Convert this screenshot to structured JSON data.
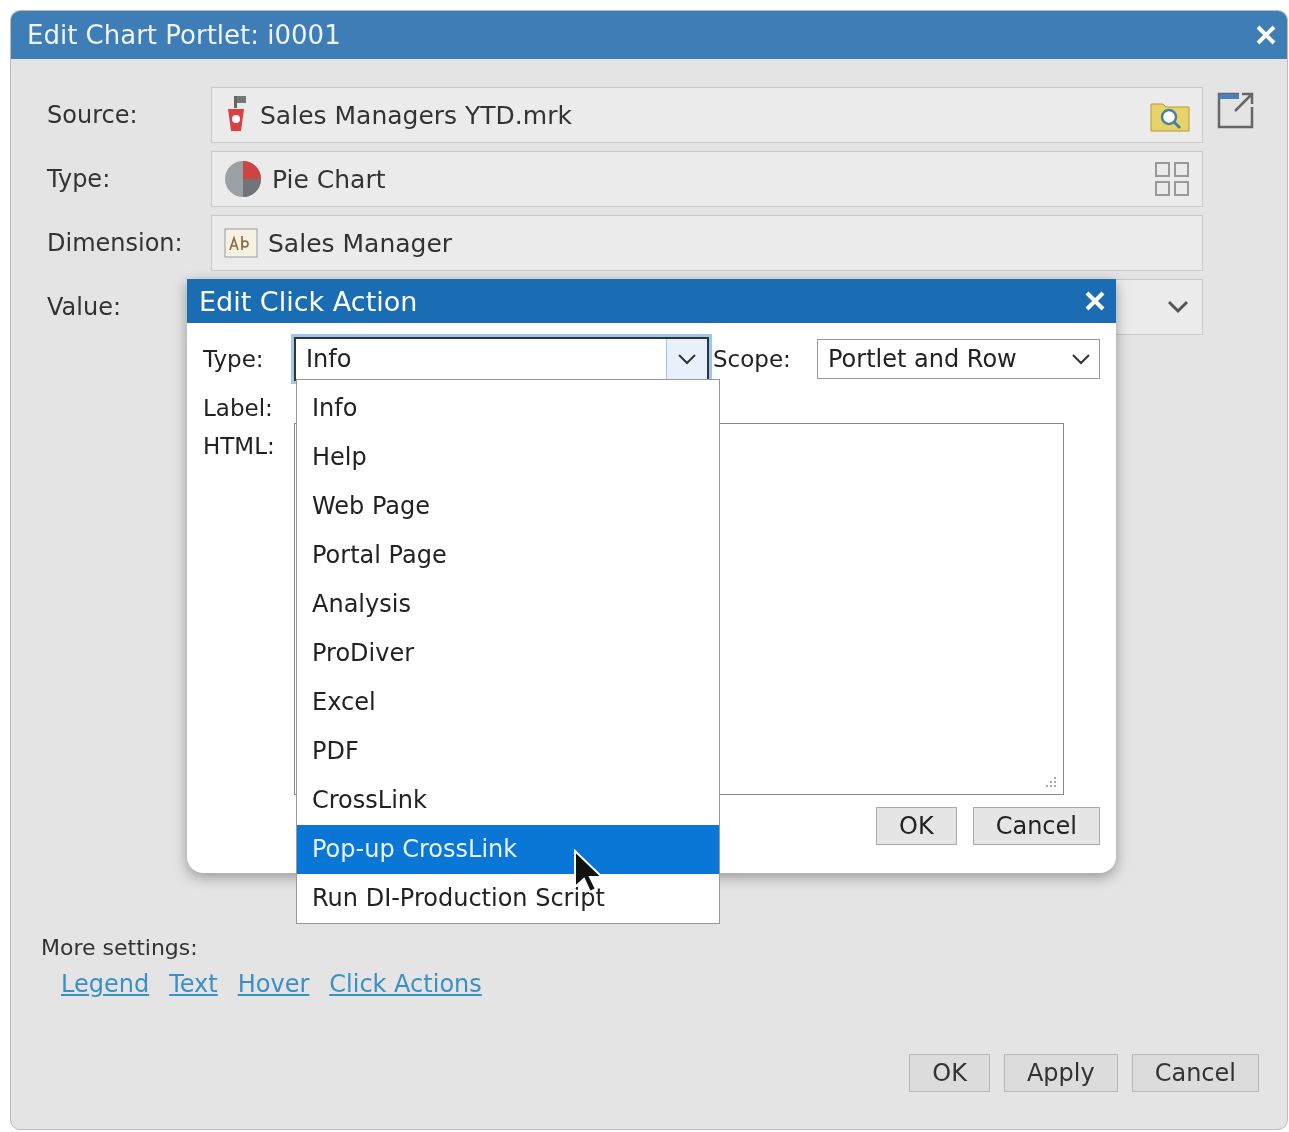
{
  "outer_dialog": {
    "title": "Edit Chart Portlet: i0001",
    "fields": [
      {
        "label": "Source:",
        "value": "Sales Managers YTD.mrk"
      },
      {
        "label": "Type:",
        "value": "Pie Chart"
      },
      {
        "label": "Dimension:",
        "value": "Sales Manager"
      },
      {
        "label": "Value:"
      }
    ],
    "more_settings": {
      "label": "More settings:",
      "links": [
        "Legend",
        "Text",
        "Hover",
        "Click Actions"
      ]
    },
    "buttons": [
      "OK",
      "Apply",
      "Cancel"
    ]
  },
  "click_action_dialog": {
    "title": "Edit Click Action",
    "type_label": "Type:",
    "type_value": "Info",
    "scope_label": "Scope:",
    "scope_value": "Portlet and Row",
    "label_label": "Label:",
    "html_label": "HTML:",
    "type_options": [
      {
        "label": "Info",
        "selected": false
      },
      {
        "label": "Help",
        "selected": false
      },
      {
        "label": "Web Page",
        "selected": false
      },
      {
        "label": "Portal Page",
        "selected": false
      },
      {
        "label": "Analysis",
        "selected": false
      },
      {
        "label": "ProDiver",
        "selected": false
      },
      {
        "label": "Excel",
        "selected": false
      },
      {
        "label": "PDF",
        "selected": false
      },
      {
        "label": "CrossLink",
        "selected": false
      },
      {
        "label": "Pop-up CrossLink",
        "selected": true
      },
      {
        "label": "Run DI-Production Script",
        "selected": false
      }
    ],
    "buttons": [
      "OK",
      "Cancel"
    ]
  }
}
